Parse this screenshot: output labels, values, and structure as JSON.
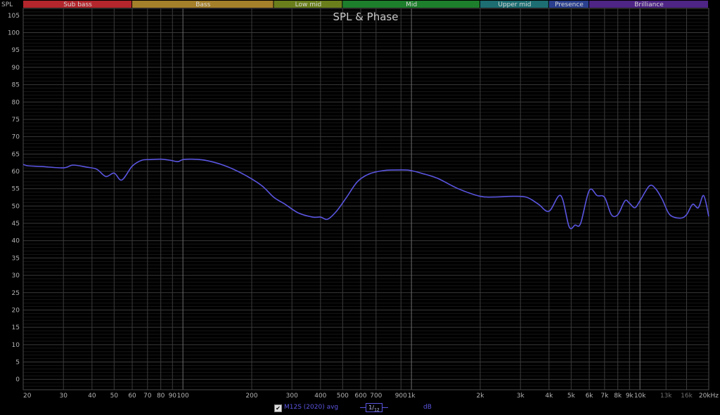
{
  "chart_data": {
    "type": "line",
    "title": "SPL & Phase",
    "ylabel": "SPL",
    "xlabel": "",
    "x_scale": "log",
    "xlim": [
      20,
      20000
    ],
    "ylim": [
      -3,
      107
    ],
    "grid": true,
    "y_ticks": [
      0,
      5,
      10,
      15,
      20,
      25,
      30,
      35,
      40,
      45,
      50,
      55,
      60,
      65,
      70,
      75,
      80,
      85,
      90,
      95,
      100,
      105
    ],
    "x_ticks": [
      {
        "value": 20,
        "label": "20"
      },
      {
        "value": 30,
        "label": "30"
      },
      {
        "value": 40,
        "label": "40"
      },
      {
        "value": 50,
        "label": "50"
      },
      {
        "value": 60,
        "label": "60"
      },
      {
        "value": 70,
        "label": "70"
      },
      {
        "value": 80,
        "label": "80"
      },
      {
        "value": 90,
        "label": "90"
      },
      {
        "value": 100,
        "label": "100"
      },
      {
        "value": 200,
        "label": "200"
      },
      {
        "value": 300,
        "label": "300"
      },
      {
        "value": 400,
        "label": "400"
      },
      {
        "value": 500,
        "label": "500"
      },
      {
        "value": 600,
        "label": "600"
      },
      {
        "value": 700,
        "label": "700"
      },
      {
        "value": 900,
        "label": "900"
      },
      {
        "value": 1000,
        "label": "1k"
      },
      {
        "value": 2000,
        "label": "2k"
      },
      {
        "value": 3000,
        "label": "3k"
      },
      {
        "value": 4000,
        "label": "4k"
      },
      {
        "value": 5000,
        "label": "5k"
      },
      {
        "value": 6000,
        "label": "6k"
      },
      {
        "value": 7000,
        "label": "7k"
      },
      {
        "value": 8000,
        "label": "8k"
      },
      {
        "value": 9000,
        "label": "9k"
      },
      {
        "value": 10000,
        "label": "10k"
      },
      {
        "value": 13000,
        "label": "13k",
        "dim": true
      },
      {
        "value": 16000,
        "label": "16k",
        "dim": true
      },
      {
        "value": 20000,
        "label": "20kHz"
      }
    ],
    "bands": [
      {
        "name": "Sub bass",
        "from": 20,
        "to": 60,
        "color": "#b3262c"
      },
      {
        "name": "Bass",
        "from": 60,
        "to": 250,
        "color": "#a5802a"
      },
      {
        "name": "Low mid",
        "from": 250,
        "to": 500,
        "color": "#6a7f1c"
      },
      {
        "name": "Mid",
        "from": 500,
        "to": 2000,
        "color": "#1d7f2c"
      },
      {
        "name": "Upper mid",
        "from": 2000,
        "to": 4000,
        "color": "#1c6e72"
      },
      {
        "name": "Presence",
        "from": 4000,
        "to": 6000,
        "color": "#2a3f8e"
      },
      {
        "name": "Brilliance",
        "from": 6000,
        "to": 20000,
        "color": "#4e2485"
      }
    ],
    "series": [
      {
        "name": "M12S (2020) avg",
        "color": "#5a55e0",
        "x": [
          20,
          21,
          24,
          30,
          33,
          38,
          42,
          46,
          50,
          54,
          60,
          66,
          72,
          80,
          88,
          95,
          100,
          110,
          125,
          150,
          180,
          220,
          250,
          280,
          320,
          370,
          400,
          430,
          470,
          520,
          580,
          650,
          750,
          850,
          950,
          1000,
          1100,
          1300,
          1600,
          2000,
          2300,
          2800,
          3200,
          3600,
          4000,
          4500,
          4900,
          5200,
          5500,
          6000,
          6500,
          7000,
          7500,
          8000,
          8600,
          9000,
          9500,
          10000,
          11000,
          11700,
          12500,
          13500,
          15000,
          16000,
          17000,
          18000,
          19000,
          20000
        ],
        "values": [
          62,
          61.6,
          61.4,
          61,
          61.8,
          61.2,
          60.6,
          58.5,
          59.5,
          57.5,
          61.5,
          63.2,
          63.4,
          63.5,
          63.2,
          62.8,
          63.4,
          63.5,
          63.2,
          61.8,
          59.5,
          56,
          52.5,
          50.5,
          48,
          46.8,
          46.8,
          46.2,
          48.5,
          52.5,
          57,
          59.2,
          60.2,
          60.4,
          60.4,
          60.2,
          59.5,
          58,
          55,
          52.8,
          52.6,
          52.8,
          52.5,
          50.5,
          48.5,
          53,
          44,
          44.5,
          45,
          54.5,
          53,
          52.5,
          47.5,
          47.5,
          51.5,
          50.8,
          49.5,
          51.5,
          55.8,
          55,
          52,
          47.5,
          46.5,
          47.5,
          50.5,
          49.5,
          53,
          47
        ]
      }
    ],
    "legend": {
      "placement": "bottom-center",
      "series_label": "M12S (2020) avg",
      "smoothing_num": "1",
      "smoothing_den": "12",
      "unit": "dB",
      "check": "✔"
    },
    "highlight_lines": [
      100,
      1000,
      10000
    ]
  }
}
